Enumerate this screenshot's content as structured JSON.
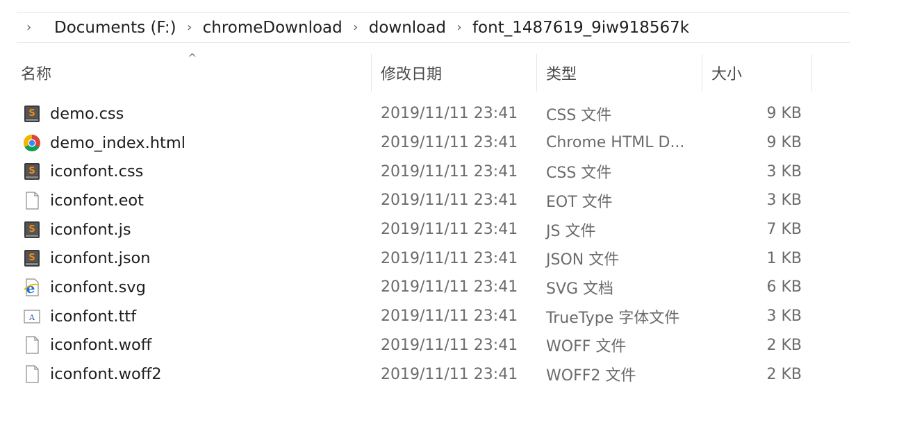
{
  "breadcrumb": {
    "items": [
      "Documents (F:)",
      "chromeDownload",
      "download",
      "font_1487619_9iw918567k"
    ]
  },
  "columns": {
    "name": "名称",
    "date": "修改日期",
    "type": "类型",
    "size": "大小"
  },
  "files": [
    {
      "name": "demo.css",
      "date": "2019/11/11 23:41",
      "type": "CSS 文件",
      "size": "9 KB",
      "icon": "sublime-file-icon"
    },
    {
      "name": "demo_index.html",
      "date": "2019/11/11 23:41",
      "type": "Chrome HTML D...",
      "size": "9 KB",
      "icon": "chrome-icon"
    },
    {
      "name": "iconfont.css",
      "date": "2019/11/11 23:41",
      "type": "CSS 文件",
      "size": "3 KB",
      "icon": "sublime-file-icon"
    },
    {
      "name": "iconfont.eot",
      "date": "2019/11/11 23:41",
      "type": "EOT 文件",
      "size": "3 KB",
      "icon": "blank-file-icon"
    },
    {
      "name": "iconfont.js",
      "date": "2019/11/11 23:41",
      "type": "JS 文件",
      "size": "7 KB",
      "icon": "sublime-file-icon"
    },
    {
      "name": "iconfont.json",
      "date": "2019/11/11 23:41",
      "type": "JSON 文件",
      "size": "1 KB",
      "icon": "sublime-file-icon"
    },
    {
      "name": "iconfont.svg",
      "date": "2019/11/11 23:41",
      "type": "SVG 文档",
      "size": "6 KB",
      "icon": "ie-file-icon"
    },
    {
      "name": "iconfont.ttf",
      "date": "2019/11/11 23:41",
      "type": "TrueType 字体文件",
      "size": "3 KB",
      "icon": "font-file-icon"
    },
    {
      "name": "iconfont.woff",
      "date": "2019/11/11 23:41",
      "type": "WOFF 文件",
      "size": "2 KB",
      "icon": "blank-file-icon"
    },
    {
      "name": "iconfont.woff2",
      "date": "2019/11/11 23:41",
      "type": "WOFF2 文件",
      "size": "2 KB",
      "icon": "blank-file-icon"
    }
  ]
}
